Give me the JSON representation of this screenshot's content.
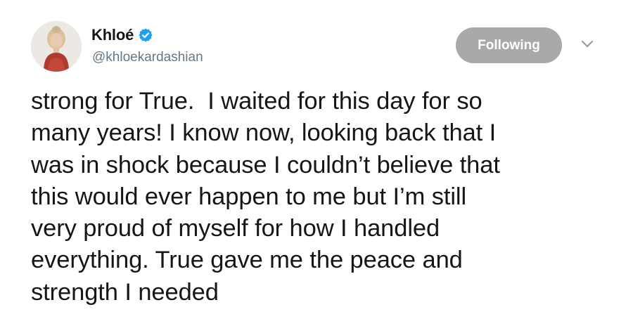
{
  "author": {
    "display_name": "Khloé",
    "handle": "@khloekardashian",
    "verified": true,
    "avatar_icon": "profile-photo"
  },
  "actions": {
    "follow_label": "Following",
    "menu_icon": "chevron-down-icon"
  },
  "tweet": {
    "lines": [
      "strong for True.  I waited for this day for so",
      "many years! I know now, looking back that I",
      "was in shock because I couldn’t believe that",
      "this would ever happen to me but I’m still",
      "very proud of myself for how I handled",
      "everything. True gave me the peace and",
      "strength I needed"
    ]
  },
  "colors": {
    "text": "#14171a",
    "secondary": "#657786",
    "verified_blue": "#1da1f2",
    "following_button_bg": "#a9a9ab"
  }
}
